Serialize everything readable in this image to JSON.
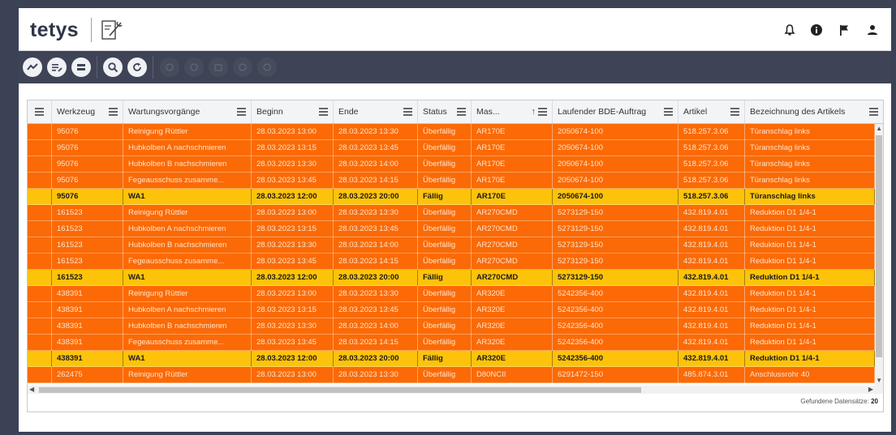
{
  "app": {
    "logo_text": "tetys"
  },
  "toolbar": {
    "buttons": [
      {
        "name": "trend-icon",
        "enabled": true
      },
      {
        "name": "list-edit-icon",
        "enabled": true
      },
      {
        "name": "rows-icon",
        "enabled": true
      },
      {
        "name": "search-icon",
        "enabled": true
      },
      {
        "name": "refresh-icon",
        "enabled": true
      },
      {
        "name": "disabled-action-1-icon",
        "enabled": false
      },
      {
        "name": "disabled-action-2-icon",
        "enabled": false
      },
      {
        "name": "disabled-calendar-icon",
        "enabled": false
      },
      {
        "name": "disabled-action-3-icon",
        "enabled": false
      },
      {
        "name": "disabled-action-4-icon",
        "enabled": false
      }
    ]
  },
  "header_icons": [
    "bell-icon",
    "info-icon",
    "flag-icon",
    "user-icon"
  ],
  "colors": {
    "overdue_row": "#fb6a06",
    "due_row": "#fdc30a",
    "toolbar": "#3e4456"
  },
  "table": {
    "columns": [
      "Werkzeug",
      "Wartungsvorgänge",
      "Beginn",
      "Ende",
      "Status",
      "Mas...",
      "Laufender BDE-Auftrag",
      "Artikel",
      "Bezeichnung des Artikels"
    ],
    "rows": [
      {
        "status_type": "over",
        "cells": [
          "95076",
          "Reinigung Rüttler",
          "28.03.2023 13:00",
          "28.03.2023 13:30",
          "Überfällig",
          "AR170E",
          "2050674-100",
          "518.257.3.06",
          "Türanschlag links"
        ]
      },
      {
        "status_type": "over",
        "cells": [
          "95076",
          "Hubkolben A nachschmieren",
          "28.03.2023 13:15",
          "28.03.2023 13:45",
          "Überfällig",
          "AR170E",
          "2050674-100",
          "518.257.3.06",
          "Türanschlag links"
        ]
      },
      {
        "status_type": "over",
        "cells": [
          "95076",
          "Hubkolben B nachschmieren",
          "28.03.2023 13:30",
          "28.03.2023 14:00",
          "Überfällig",
          "AR170E",
          "2050674-100",
          "518.257.3.06",
          "Türanschlag links"
        ]
      },
      {
        "status_type": "over",
        "cells": [
          "95076",
          "Fegeausschuss zusamme...",
          "28.03.2023 13:45",
          "28.03.2023 14:15",
          "Überfällig",
          "AR170E",
          "2050674-100",
          "518.257.3.06",
          "Türanschlag links"
        ]
      },
      {
        "status_type": "due",
        "cells": [
          "95076",
          "WA1",
          "28.03.2023 12:00",
          "28.03.2023 20:00",
          "Fällig",
          "AR170E",
          "2050674-100",
          "518.257.3.06",
          "Türanschlag links"
        ]
      },
      {
        "status_type": "over",
        "cells": [
          "161523",
          "Reinigung Rüttler",
          "28.03.2023 13:00",
          "28.03.2023 13:30",
          "Überfällig",
          "AR270CMD",
          "5273129-150",
          "432.819.4.01",
          "Reduktion D1 1/4-1"
        ]
      },
      {
        "status_type": "over",
        "cells": [
          "161523",
          "Hubkolben A nachschmieren",
          "28.03.2023 13:15",
          "28.03.2023 13:45",
          "Überfällig",
          "AR270CMD",
          "5273129-150",
          "432.819.4.01",
          "Reduktion D1 1/4-1"
        ]
      },
      {
        "status_type": "over",
        "cells": [
          "161523",
          "Hubkolben B nachschmieren",
          "28.03.2023 13:30",
          "28.03.2023 14:00",
          "Überfällig",
          "AR270CMD",
          "5273129-150",
          "432.819.4.01",
          "Reduktion D1 1/4-1"
        ]
      },
      {
        "status_type": "over",
        "cells": [
          "161523",
          "Fegeausschuss zusamme...",
          "28.03.2023 13:45",
          "28.03.2023 14:15",
          "Überfällig",
          "AR270CMD",
          "5273129-150",
          "432.819.4.01",
          "Reduktion D1 1/4-1"
        ]
      },
      {
        "status_type": "due",
        "cells": [
          "161523",
          "WA1",
          "28.03.2023 12:00",
          "28.03.2023 20:00",
          "Fällig",
          "AR270CMD",
          "5273129-150",
          "432.819.4.01",
          "Reduktion D1 1/4-1"
        ]
      },
      {
        "status_type": "over",
        "cells": [
          "438391",
          "Reinigung Rüttler",
          "28.03.2023 13:00",
          "28.03.2023 13:30",
          "Überfällig",
          "AR320E",
          "5242356-400",
          "432.819.4.01",
          "Reduktion D1 1/4-1"
        ]
      },
      {
        "status_type": "over",
        "cells": [
          "438391",
          "Hubkolben A nachschmieren",
          "28.03.2023 13:15",
          "28.03.2023 13:45",
          "Überfällig",
          "AR320E",
          "5242356-400",
          "432.819.4.01",
          "Reduktion D1 1/4-1"
        ]
      },
      {
        "status_type": "over",
        "cells": [
          "438391",
          "Hubkolben B nachschmieren",
          "28.03.2023 13:30",
          "28.03.2023 14:00",
          "Überfällig",
          "AR320E",
          "5242356-400",
          "432.819.4.01",
          "Reduktion D1 1/4-1"
        ]
      },
      {
        "status_type": "over",
        "cells": [
          "438391",
          "Fegeausschuss zusamme...",
          "28.03.2023 13:45",
          "28.03.2023 14:15",
          "Überfällig",
          "AR320E",
          "5242356-400",
          "432.819.4.01",
          "Reduktion D1 1/4-1"
        ]
      },
      {
        "status_type": "due",
        "cells": [
          "438391",
          "WA1",
          "28.03.2023 12:00",
          "28.03.2023 20:00",
          "Fällig",
          "AR320E",
          "5242356-400",
          "432.819.4.01",
          "Reduktion D1 1/4-1"
        ]
      },
      {
        "status_type": "over",
        "cells": [
          "262475",
          "Reinigung Rüttler",
          "28.03.2023 13:00",
          "28.03.2023 13:30",
          "Überfällig",
          "D80NCII",
          "6291472-150",
          "485.874.3.01",
          "Anschlussrohr 40"
        ]
      }
    ]
  },
  "footer": {
    "found_label": "Gefundene Datensätze:",
    "found_count": "20"
  }
}
